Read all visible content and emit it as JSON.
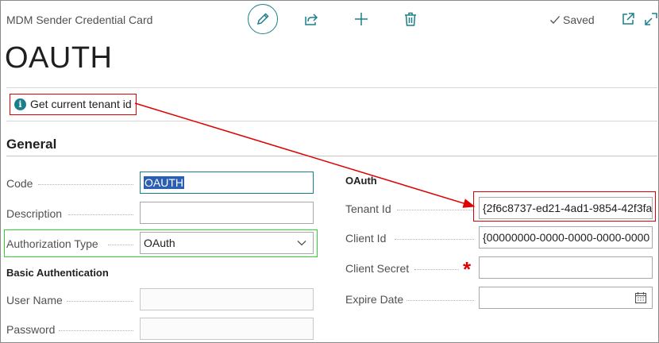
{
  "header": {
    "caption": "MDM Sender Credential Card",
    "title": "OAUTH",
    "saved_label": "Saved"
  },
  "actions": {
    "get_tenant": "Get current tenant id"
  },
  "general": {
    "section_title": "General",
    "code": {
      "label": "Code",
      "value": "OAUTH"
    },
    "description": {
      "label": "Description",
      "value": ""
    },
    "authorization_type": {
      "label": "Authorization Type",
      "value": "OAuth"
    },
    "basic_auth_title": "Basic Authentication",
    "user_name": {
      "label": "User Name",
      "value": ""
    },
    "password": {
      "label": "Password",
      "value": ""
    }
  },
  "oauth": {
    "title": "OAuth",
    "tenant_id": {
      "label": "Tenant Id",
      "value": "{2f6c8737-ed21-4ad1-9854-42f3fa"
    },
    "client_id": {
      "label": "Client Id",
      "value": "{00000000-0000-0000-0000-0000"
    },
    "client_secret": {
      "label": "Client Secret",
      "value": ""
    },
    "expire_date": {
      "label": "Expire Date",
      "value": ""
    }
  },
  "colors": {
    "accent": "#1a7f8a",
    "annotation_red": "#e00000",
    "annotation_green": "#33d033"
  }
}
